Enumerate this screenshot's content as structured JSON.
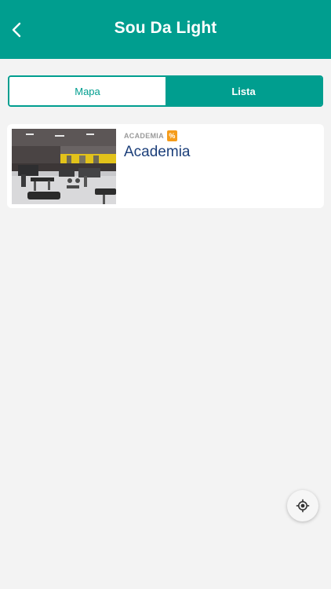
{
  "header": {
    "title": "Sou Da Light",
    "back_icon": "chevron-left-icon"
  },
  "segmented_control": {
    "tabs": [
      {
        "label": "Mapa",
        "selected": false
      },
      {
        "label": "Lista",
        "selected": true
      }
    ]
  },
  "results": [
    {
      "category": "ACADEMIA",
      "badge": "%",
      "title": "Academia",
      "image": "gym-interior-photo"
    }
  ],
  "fab": {
    "icon": "my-location-icon"
  },
  "colors": {
    "primary": "#009e8f",
    "title_text": "#1c3f7a",
    "badge": "#f59c1a",
    "background": "#f3f3f3"
  }
}
